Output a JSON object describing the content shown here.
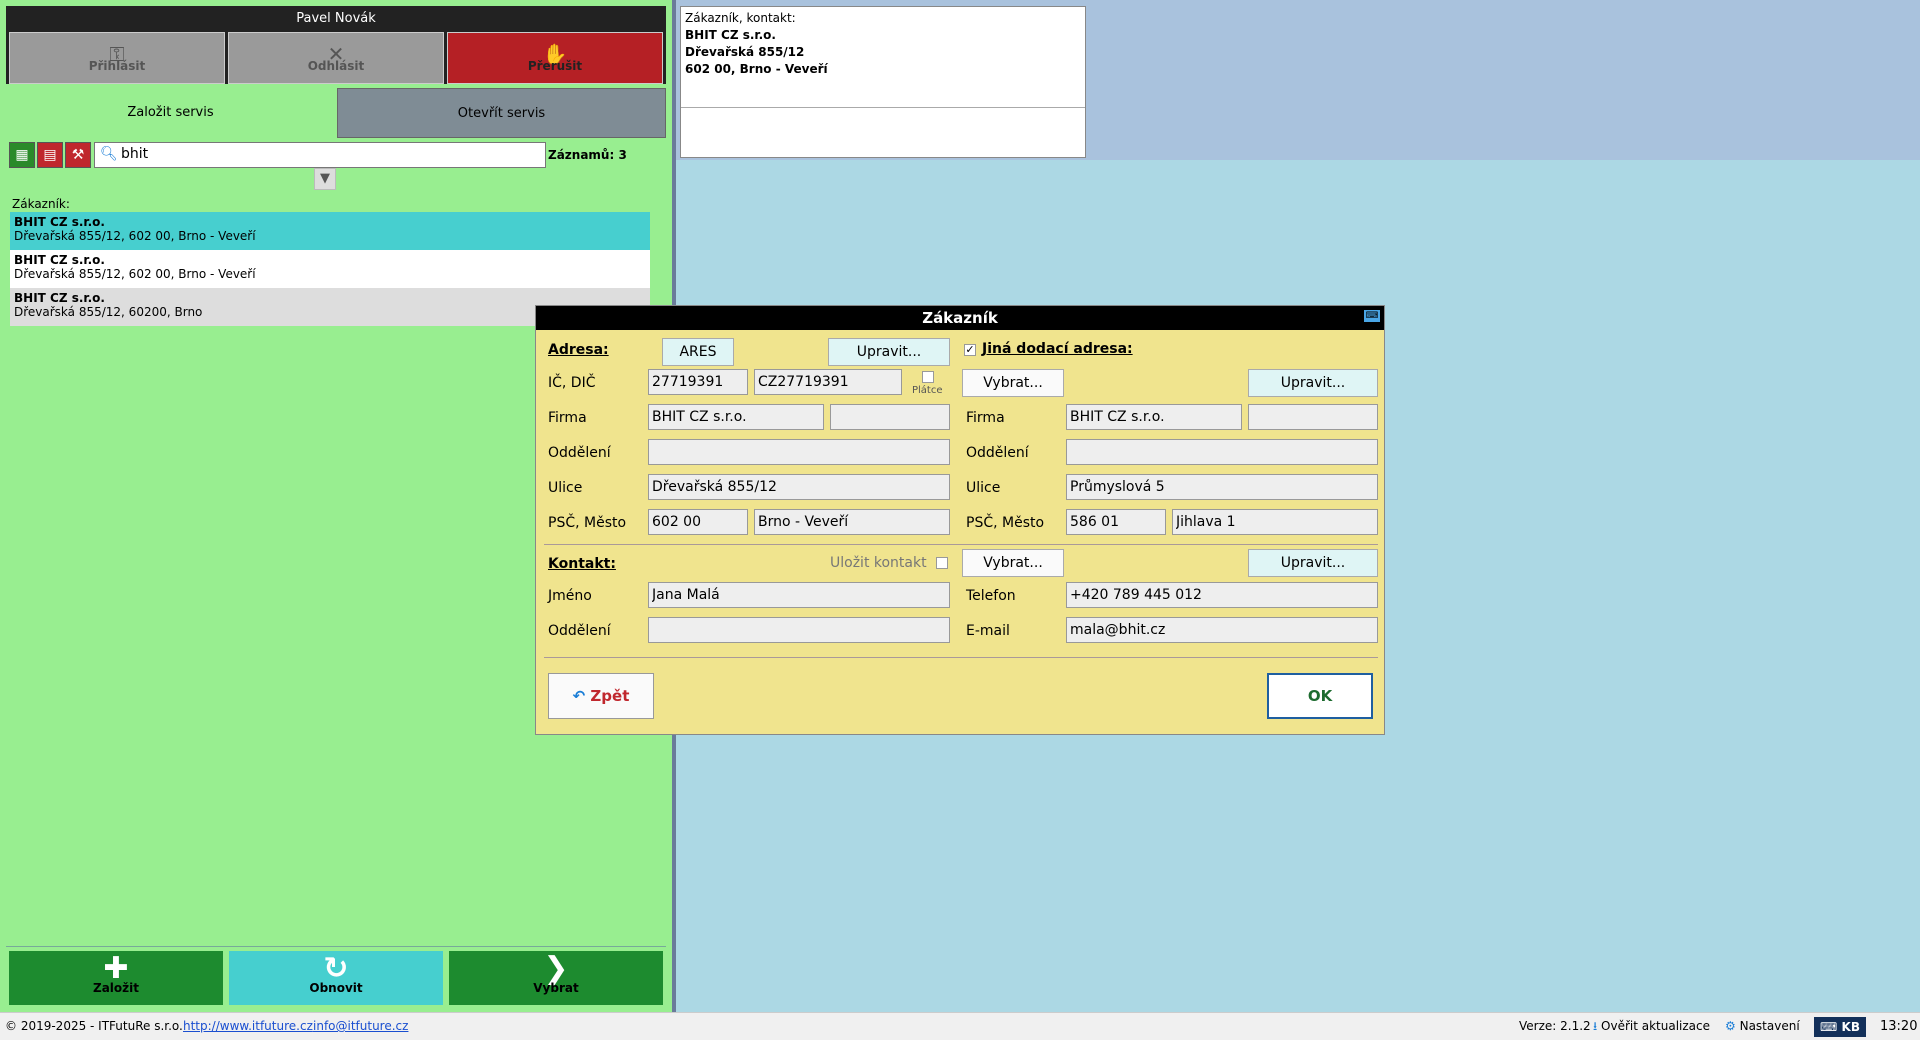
{
  "top": {
    "user": "Pavel Novák",
    "login": "Přihlásit",
    "logout": "Odhlásit",
    "stop": "Přerušit"
  },
  "tabs": {
    "new": "Založit servis",
    "open": "Otevřít servis"
  },
  "search": {
    "value": "bhit",
    "records": "Záznamů: 3"
  },
  "list": {
    "label": "Zákazník:",
    "items": [
      {
        "name": "BHIT CZ s.r.o.",
        "addr": "Dřevařská 855/12, 602 00, Brno - Veveří"
      },
      {
        "name": "BHIT CZ s.r.o.",
        "addr": "Dřevařská 855/12, 602 00, Brno - Veveří"
      },
      {
        "name": "BHIT CZ s.r.o.",
        "addr": "Dřevařská 855/12, 60200, Brno"
      }
    ]
  },
  "bottom": {
    "create": "Založit",
    "refresh": "Obnovit",
    "select": "Vybrat"
  },
  "contact": {
    "header": "Zákazník, kontakt:",
    "line1": "BHIT CZ s.r.o.",
    "line2": "Dřevařská 855/12",
    "line3": "602 00, Brno - Veveří"
  },
  "dialog": {
    "title": "Zákazník",
    "address_label": "Adresa:",
    "ares": "ARES",
    "edit": "Upravit...",
    "other_addr": "Jiná dodací adresa:",
    "other_addr_checked": true,
    "pick": "Vybrat...",
    "ic_dic_label": "IČ, DIČ",
    "ic": "27719391",
    "dic": "CZ27719391",
    "payer": "Plátce",
    "firma_label": "Firma",
    "firma": "BHIT CZ s.r.o.",
    "firma2": "",
    "dept_label": "Oddělení",
    "dept": "",
    "street_label": "Ulice",
    "street": "Dřevařská 855/12",
    "zip_city_label": "PSČ, Město",
    "zip": "602 00",
    "city": "Brno - Veveří",
    "d_firma": "BHIT CZ s.r.o.",
    "d_firma2": "",
    "d_dept": "",
    "d_street": "Průmyslová 5",
    "d_zip": "586 01",
    "d_city": "Jihlava 1",
    "contact_label": "Kontakt:",
    "save_contact": "Uložit kontakt",
    "name_label": "Jméno",
    "name": "Jana Malá",
    "c_dept_label": "Oddělení",
    "c_dept": "",
    "phone_label": "Telefon",
    "phone": "+420 789 445 012",
    "email_label": "E-mail",
    "email": "mala@bhit.cz",
    "back": "Zpět",
    "ok": "OK"
  },
  "status": {
    "copyright": "© 2019-2025 - ITFutuRe s.r.o.",
    "link1": "http://www.itfuture.cz",
    "link2": "info@itfuture.cz",
    "version": "Verze: 2.1.2",
    "check": "Ověřit aktualizace",
    "settings": "Nastavení",
    "kb": "KB",
    "time": "13:20"
  }
}
